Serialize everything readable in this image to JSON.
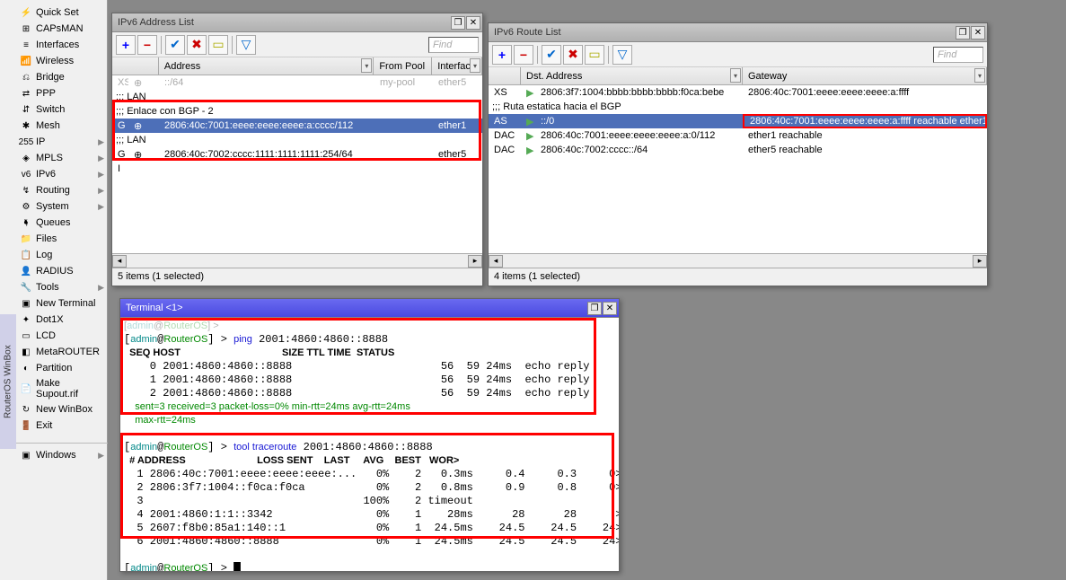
{
  "sidebar": {
    "items": [
      {
        "icon": "⚡",
        "label": "Quick Set",
        "arrow": false
      },
      {
        "icon": "⊞",
        "label": "CAPsMAN",
        "arrow": false
      },
      {
        "icon": "≡",
        "label": "Interfaces",
        "arrow": false
      },
      {
        "icon": "📶",
        "label": "Wireless",
        "arrow": false
      },
      {
        "icon": "⎌",
        "label": "Bridge",
        "arrow": false
      },
      {
        "icon": "⇄",
        "label": "PPP",
        "arrow": false
      },
      {
        "icon": "⇵",
        "label": "Switch",
        "arrow": false
      },
      {
        "icon": "✱",
        "label": "Mesh",
        "arrow": false
      },
      {
        "icon": "255",
        "label": "IP",
        "arrow": true
      },
      {
        "icon": "◈",
        "label": "MPLS",
        "arrow": true
      },
      {
        "icon": "v6",
        "label": "IPv6",
        "arrow": true
      },
      {
        "icon": "↯",
        "label": "Routing",
        "arrow": true
      },
      {
        "icon": "⚙",
        "label": "System",
        "arrow": true
      },
      {
        "icon": "🖣",
        "label": "Queues",
        "arrow": false
      },
      {
        "icon": "📁",
        "label": "Files",
        "arrow": false
      },
      {
        "icon": "📋",
        "label": "Log",
        "arrow": false
      },
      {
        "icon": "👤",
        "label": "RADIUS",
        "arrow": false
      },
      {
        "icon": "🔧",
        "label": "Tools",
        "arrow": true
      },
      {
        "icon": "▣",
        "label": "New Terminal",
        "arrow": false
      },
      {
        "icon": "✦",
        "label": "Dot1X",
        "arrow": false
      },
      {
        "icon": "▭",
        "label": "LCD",
        "arrow": false
      },
      {
        "icon": "◧",
        "label": "MetaROUTER",
        "arrow": false
      },
      {
        "icon": "◐",
        "label": "Partition",
        "arrow": false
      },
      {
        "icon": "📄",
        "label": "Make Supout.rif",
        "arrow": false
      },
      {
        "icon": "↻",
        "label": "New WinBox",
        "arrow": false
      },
      {
        "icon": "🚪",
        "label": "Exit",
        "arrow": false
      }
    ],
    "windows_label": "Windows",
    "vtab": "RouterOS WinBox"
  },
  "addr_win": {
    "title": "IPv6 Address List",
    "find": "Find",
    "cols": {
      "blank": "",
      "addr": "Address",
      "pool": "From Pool",
      "iface": "Interface"
    },
    "rows": [
      {
        "type": "dim",
        "flag": "XS",
        "addr": "::/64",
        "pool": "my-pool",
        "iface": "ether5"
      },
      {
        "type": "comment",
        "text": ";;; LAN"
      },
      {
        "type": "comment",
        "text": ";;; Enlace con BGP - 2"
      },
      {
        "type": "sel",
        "flag": "G",
        "addr": "2806:40c:7001:eeee:eeee:eeee:a:cccc/112",
        "pool": "",
        "iface": "ether1"
      },
      {
        "type": "comment",
        "text": ";;; LAN"
      },
      {
        "type": "plain",
        "flag": "G",
        "addr": "2806:40c:7002:cccc:1111:1111:1111:254/64",
        "pool": "",
        "iface": "ether5"
      },
      {
        "type": "plain",
        "flag": "I",
        "addr": "",
        "pool": "",
        "iface": ""
      }
    ],
    "status": "5 items (1 selected)"
  },
  "route_win": {
    "title": "IPv6 Route List",
    "find": "Find",
    "cols": {
      "blank": "",
      "dst": "Dst. Address",
      "gw": "Gateway"
    },
    "rows": [
      {
        "flag": "XS",
        "mark": "▶",
        "dst": "2806:3f7:1004:bbbb:bbbb:bbbb:f0ca:bebe",
        "gw": "2806:40c:7001:eeee:eeee:eeee:a:ffff"
      },
      {
        "type": "comment",
        "text": ";;; Ruta estatica hacia el BGP"
      },
      {
        "flag": "AS",
        "mark": "▶",
        "dst": "::/0",
        "gw": "2806:40c:7001:eeee:eeee:eeee:a:ffff reachable ether1",
        "sel": true,
        "hl": true
      },
      {
        "flag": "DAC",
        "mark": "▶",
        "dst": "2806:40c:7001:eeee:eeee:eeee:a:0/112",
        "gw": "ether1 reachable"
      },
      {
        "flag": "DAC",
        "mark": "▶",
        "dst": "2806:40c:7002:cccc::/64",
        "gw": "ether5 reachable"
      }
    ],
    "status": "4 items (1 selected)"
  },
  "term_win": {
    "title": "Terminal <1>",
    "prompt_user": "admin",
    "prompt_host": "RouterOS",
    "ping_cmd": "ping 2001:4860:4860::8888",
    "ping_header": "  SEQ HOST                                     SIZE TTL TIME  STATUS",
    "ping_rows": [
      "    0 2001:4860:4860::8888                       56  59 24ms  echo reply",
      "    1 2001:4860:4860::8888                       56  59 24ms  echo reply",
      "    2 2001:4860:4860::8888                       56  59 24ms  echo reply"
    ],
    "ping_sum_a": "    sent=3 received=3 packet-loss=0% min-rtt=24ms avg-rtt=24ms",
    "ping_sum_b": "    max-rtt=24ms",
    "trace_cmd": "tool traceroute 2001:4860:4860::8888",
    "trace_header": "  # ADDRESS                          LOSS SENT    LAST     AVG    BEST   WOR>",
    "trace_rows": [
      "  1 2806:40c:7001:eeee:eeee:eeee:...   0%    2   0.3ms     0.4     0.3     0>",
      "  2 2806:3f7:1004::f0ca:f0ca           0%    2   0.8ms     0.9     0.8     0>",
      "  3                                  100%    2 timeout",
      "  4 2001:4860:1:1::3342                0%    1    28ms      28      28      >",
      "  5 2607:f8b0:85a1:140::1              0%    1  24.5ms    24.5    24.5    24>",
      "  6 2001:4860:4860::8888               0%    1  24.5ms    24.5    24.5    24>"
    ],
    "cursor": "█"
  }
}
